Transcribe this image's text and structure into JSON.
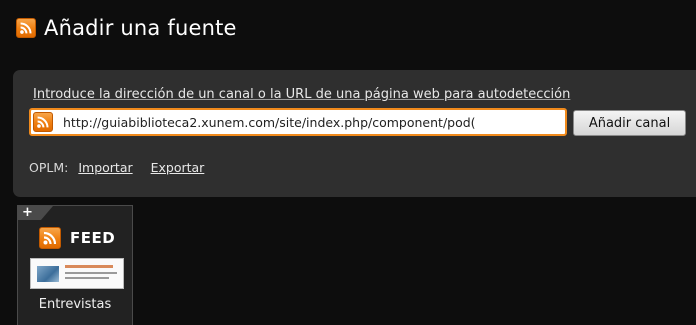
{
  "header": {
    "title": "Añadir una fuente"
  },
  "form": {
    "instruction": "Introduce la dirección de un canal o la URL de una página web para autodetección",
    "url_value": "http://guiabiblioteca2.xunem.com/site/index.php/component/pod(",
    "add_button": "Añadir canal"
  },
  "opml": {
    "label": "OPLM:",
    "import_label": "Importar",
    "export_label": "Exportar"
  },
  "feed_card": {
    "plus": "+",
    "badge": "FEED",
    "name": "Entrevistas"
  },
  "colors": {
    "accent": "#f08a1c",
    "background": "#0d0d0d",
    "panel": "#2f2f2f"
  },
  "icons": [
    "rss-icon",
    "plus-icon"
  ]
}
